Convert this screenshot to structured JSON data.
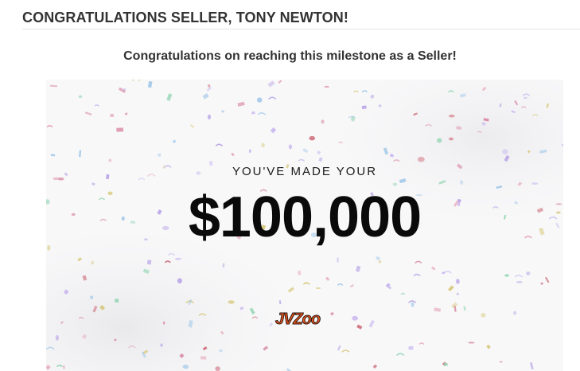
{
  "header": {
    "title": "CONGRATULATIONS SELLER, TONY NEWTON!"
  },
  "milestone": {
    "subtitle": "Congratulations on reaching this milestone as a Seller!",
    "made_label": "YOU'VE MADE YOUR",
    "amount": "$100,000",
    "logo_text": "JVZoo"
  },
  "colors": {
    "text_dark": "#333333",
    "logo_orange": "#e8531e",
    "logo_outline": "#2b1a12",
    "confetti": [
      "#b9a5e6",
      "#d98aa6",
      "#8fd4b0",
      "#c9b8ef",
      "#e6a6b8",
      "#a4c9e8",
      "#d7c77a",
      "#cf6d7a"
    ]
  }
}
